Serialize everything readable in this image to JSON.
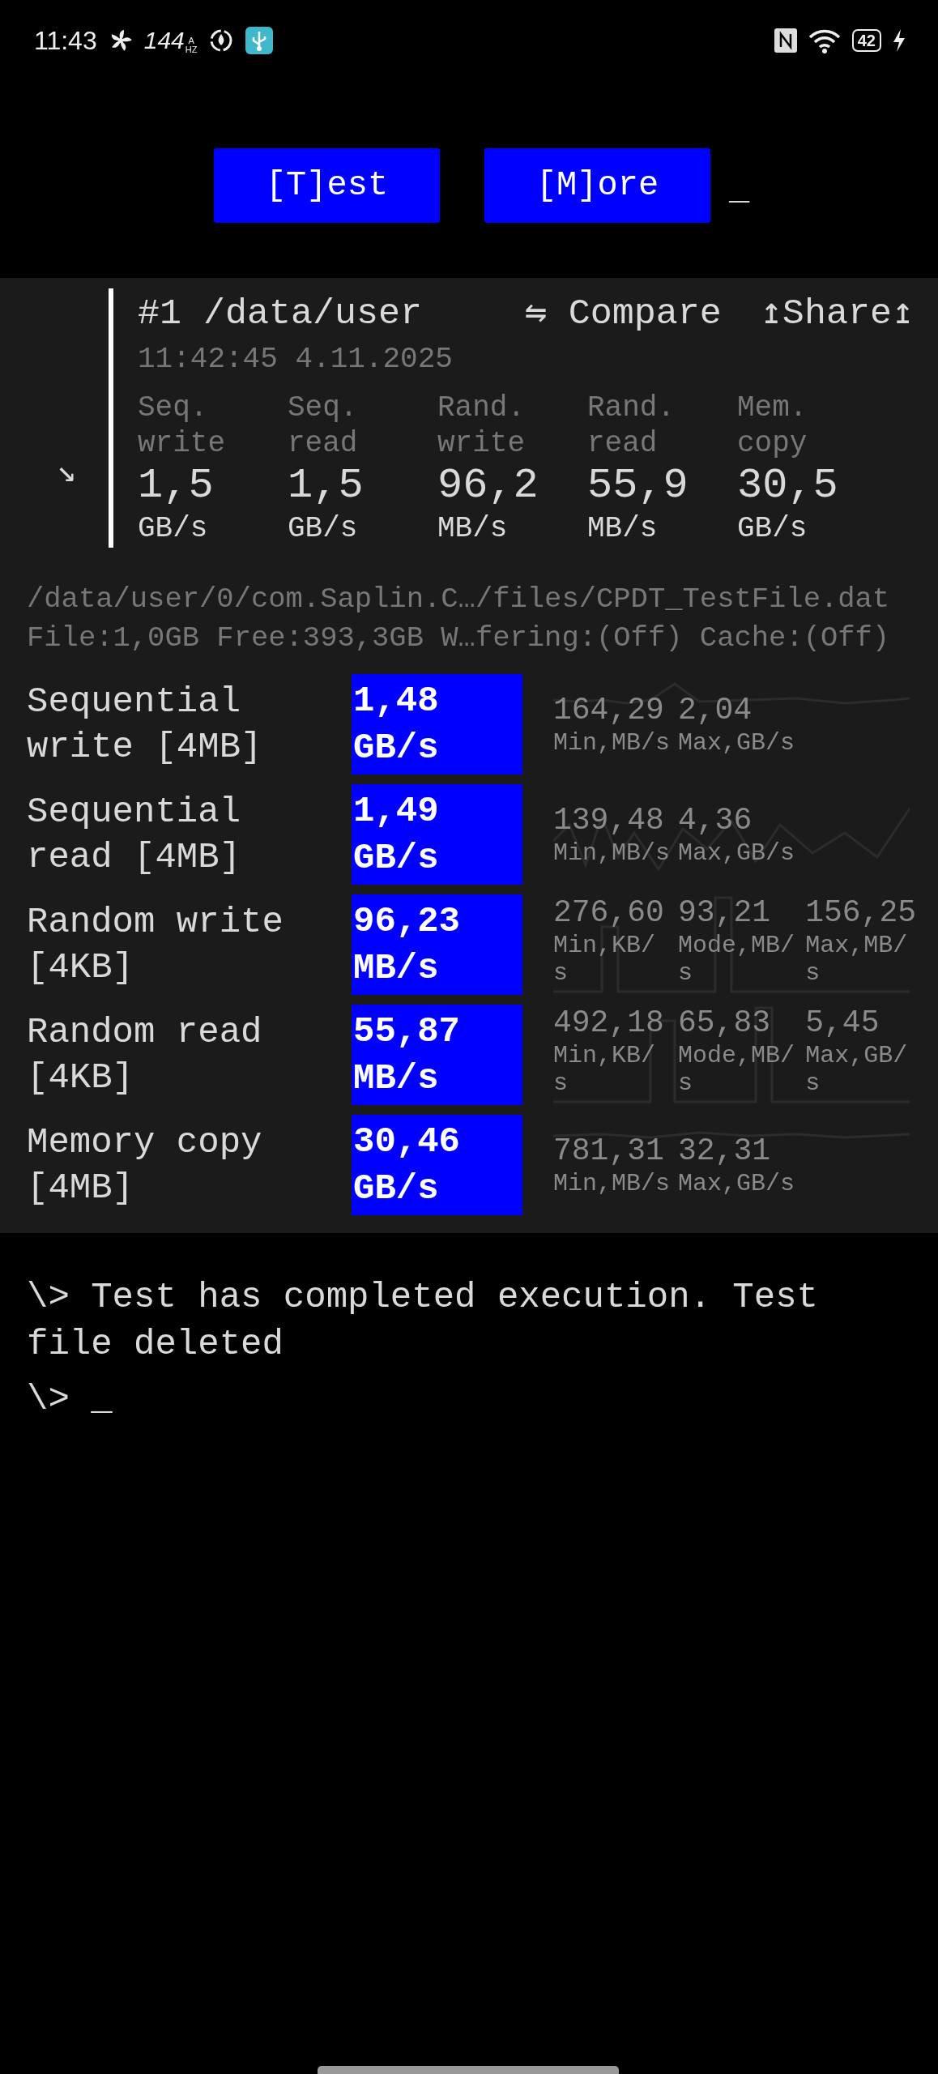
{
  "status_bar": {
    "time": "11:43",
    "refresh_rate": "144",
    "refresh_mode": "A",
    "refresh_unit": "HZ",
    "battery": "42"
  },
  "toolbar": {
    "buttons": [
      "[T]est",
      "[M]ore"
    ],
    "cursor": "_"
  },
  "result": {
    "title": "#1 /data/user",
    "compare": "⇋ Compare",
    "share": "↥Share↥",
    "timestamp": "11:42:45 4.11.2025",
    "expand": "↘",
    "summary": [
      {
        "label": "Seq. write",
        "value": "1,5",
        "unit": "GB/s"
      },
      {
        "label": "Seq. read",
        "value": "1,5",
        "unit": "GB/s"
      },
      {
        "label": "Rand. write",
        "value": "96,2",
        "unit": "MB/s"
      },
      {
        "label": "Rand. read",
        "value": "55,9",
        "unit": "MB/s"
      },
      {
        "label": "Mem. copy",
        "value": "30,5",
        "unit": "GB/s"
      }
    ]
  },
  "file_path": "/data/user/0/com.Saplin.C…/files/CPDT_TestFile.dat",
  "file_info": "File:1,0GB Free:393,3GB W…fering:(Off) Cache:(Off)",
  "tests": [
    {
      "name": "Sequential write [4MB]",
      "value": "1,48",
      "unit": "GB/s",
      "stats": [
        {
          "value": "164,29",
          "label": "Min,MB/s"
        },
        {
          "value": "2,04",
          "label": "Max,GB/s"
        }
      ]
    },
    {
      "name": "Sequential read [4MB]",
      "value": "1,49",
      "unit": "GB/s",
      "stats": [
        {
          "value": "139,48",
          "label": "Min,MB/s"
        },
        {
          "value": "4,36",
          "label": "Max,GB/s"
        }
      ]
    },
    {
      "name": "Random write [4KB]",
      "value": "96,23",
      "unit": "MB/s",
      "stats": [
        {
          "value": "276,60",
          "label": "Min,KB/s"
        },
        {
          "value": "93,21",
          "label": "Mode,MB/s"
        },
        {
          "value": "156,25",
          "label": "Max,MB/s"
        }
      ]
    },
    {
      "name": "Random read [4KB]",
      "value": "55,87",
      "unit": "MB/s",
      "stats": [
        {
          "value": "492,18",
          "label": "Min,KB/s"
        },
        {
          "value": "65,83",
          "label": "Mode,MB/s"
        },
        {
          "value": "5,45",
          "label": "Max,GB/s"
        }
      ]
    },
    {
      "name": "Memory copy [4MB]",
      "value": "30,46",
      "unit": "GB/s",
      "stats": [
        {
          "value": "781,31",
          "label": "Min,MB/s"
        },
        {
          "value": "32,31",
          "label": "Max,GB/s"
        }
      ]
    }
  ],
  "console": {
    "lines": [
      "\\> Test has completed execution. Test file deleted"
    ],
    "prompt": "\\> _"
  }
}
